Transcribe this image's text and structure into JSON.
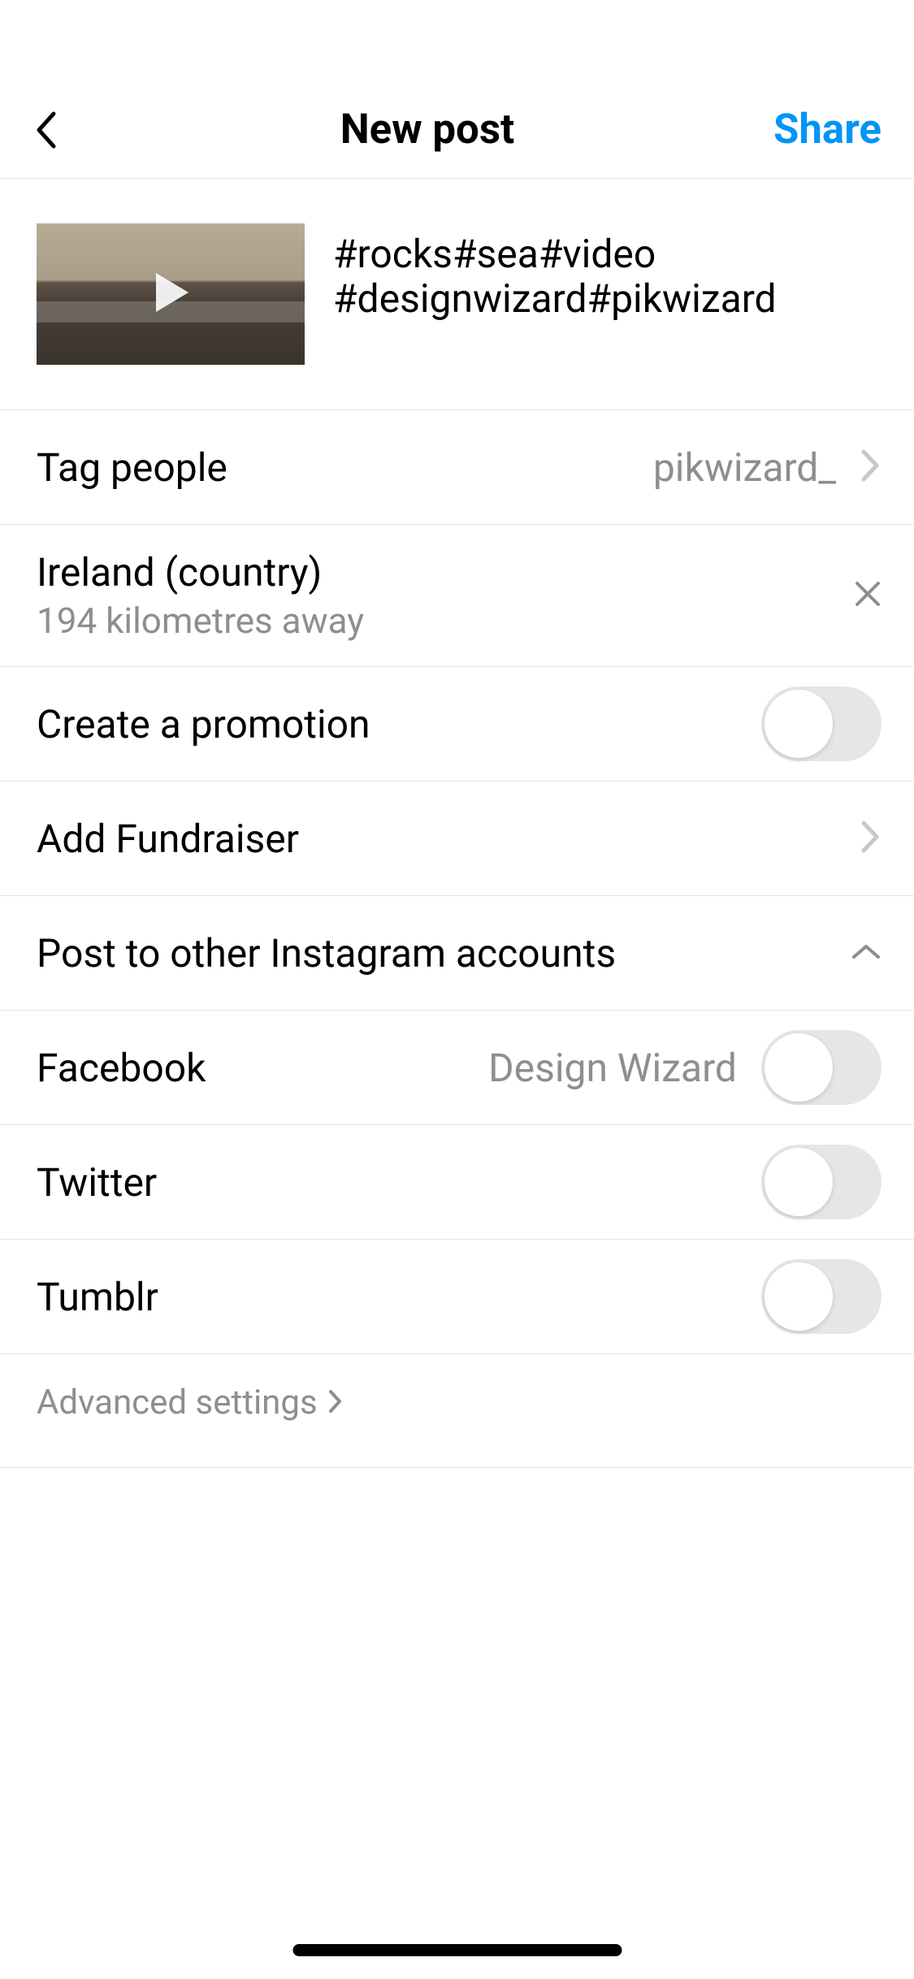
{
  "header": {
    "title": "New post",
    "share_label": "Share"
  },
  "caption": {
    "text": "#rocks#sea#video\n#designwizard#pikwizard"
  },
  "tag_people": {
    "label": "Tag people",
    "value": "pikwizard_"
  },
  "location": {
    "name": "Ireland (country)",
    "distance": "194 kilometres away"
  },
  "promotion": {
    "label": "Create a promotion"
  },
  "fundraiser": {
    "label": "Add Fundraiser"
  },
  "other_accounts": {
    "label": "Post to other Instagram accounts"
  },
  "share_targets": {
    "facebook": {
      "label": "Facebook",
      "account": "Design Wizard"
    },
    "twitter": {
      "label": "Twitter"
    },
    "tumblr": {
      "label": "Tumblr"
    }
  },
  "advanced": {
    "label": "Advanced settings"
  }
}
